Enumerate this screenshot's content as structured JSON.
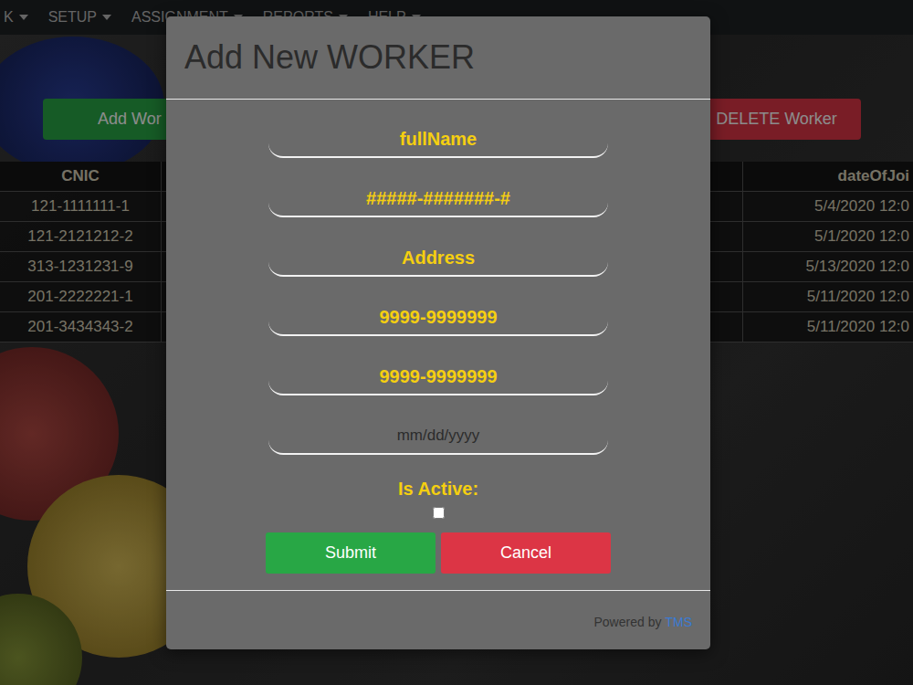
{
  "navbar": {
    "items": [
      "K",
      "SETUP",
      "ASSIGNMENT",
      "REPORTS",
      "HELP"
    ]
  },
  "toolbar": {
    "buttons": [
      {
        "label": "Add Wor",
        "kind": "add"
      },
      {
        "label": "DELETE Worker",
        "kind": "delete"
      }
    ]
  },
  "table": {
    "columns": [
      "CNIC",
      "dateOfJoi"
    ],
    "rows": [
      {
        "cnic": "121-1111111-1",
        "dateOfJoining": "5/4/2020 12:0"
      },
      {
        "cnic": "121-2121212-2",
        "dateOfJoining": "5/1/2020 12:0"
      },
      {
        "cnic": "313-1231231-9",
        "dateOfJoining": "5/13/2020 12:0"
      },
      {
        "cnic": "201-2222221-1",
        "dateOfJoining": "5/11/2020 12:0"
      },
      {
        "cnic": "201-3434343-2",
        "dateOfJoining": "5/11/2020 12:0"
      }
    ]
  },
  "dialog": {
    "title": "Add New WORKER",
    "fields": [
      {
        "placeholder": "fullName",
        "kind": "text"
      },
      {
        "placeholder": "#####-#######-#",
        "kind": "text"
      },
      {
        "placeholder": "Address",
        "kind": "text"
      },
      {
        "placeholder": "9999-9999999",
        "kind": "text"
      },
      {
        "placeholder": "9999-9999999",
        "kind": "text"
      },
      {
        "placeholder": "mm/dd/yyyy",
        "kind": "date"
      }
    ],
    "checkbox": {
      "label": "Is Active:",
      "checked": false
    },
    "buttons": [
      {
        "label": "Submit",
        "kind": "submit"
      },
      {
        "label": "Cancel",
        "kind": "cancel"
      }
    ],
    "footer": {
      "text": "Powered by",
      "link": "TMS"
    }
  }
}
